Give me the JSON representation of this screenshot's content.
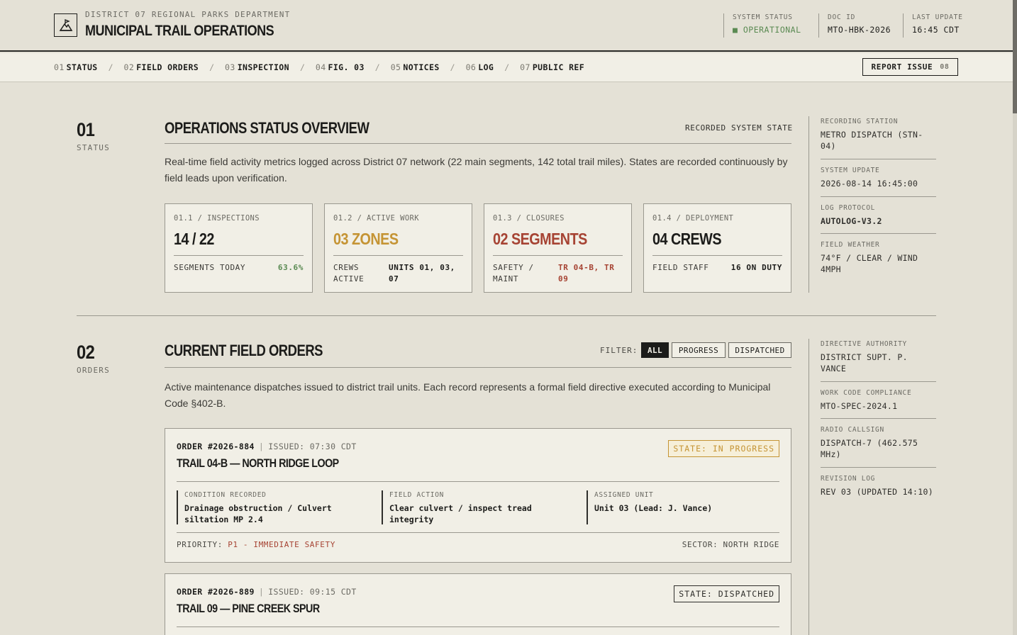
{
  "header": {
    "department": "DISTRICT 07 REGIONAL PARKS DEPARTMENT",
    "title": "MUNICIPAL TRAIL OPERATIONS",
    "system_status_label": "SYSTEM STATUS",
    "system_status_value": "OPERATIONAL",
    "doc_id_label": "DOC ID",
    "doc_id_value": "MTO-HBK-2026",
    "last_update_label": "LAST UPDATE",
    "last_update_value": "16:45 CDT"
  },
  "nav": {
    "items": [
      {
        "num": "01",
        "label": "STATUS"
      },
      {
        "num": "02",
        "label": "FIELD ORDERS"
      },
      {
        "num": "03",
        "label": "INSPECTION"
      },
      {
        "num": "04",
        "label": "FIG. 03"
      },
      {
        "num": "05",
        "label": "NOTICES"
      },
      {
        "num": "06",
        "label": "LOG"
      },
      {
        "num": "07",
        "label": "PUBLIC REF"
      }
    ],
    "separator": "/",
    "report_label": "REPORT ISSUE",
    "report_count": "08"
  },
  "section1": {
    "num": "01",
    "tag": "STATUS",
    "title": "OPERATIONS STATUS OVERVIEW",
    "right_label": "RECORDED SYSTEM STATE",
    "description": "Real-time field activity metrics logged across District 07 network (22 main segments, 142 total trail miles). States are recorded continuously by field leads upon verification.",
    "cards": [
      {
        "label": "01.1 / INSPECTIONS",
        "value": "14 / 22",
        "foot_left": "SEGMENTS TODAY",
        "foot_right": "63.6%"
      },
      {
        "label": "01.2 / ACTIVE WORK",
        "value": "03 ZONES",
        "foot_left": "CREWS\nACTIVE",
        "foot_right": "UNITS 01, 03,\n07"
      },
      {
        "label": "01.3 / CLOSURES",
        "value": "02 SEGMENTS",
        "foot_left": "SAFETY /\nMAINT",
        "foot_right": "TR 04-B, TR\n09"
      },
      {
        "label": "01.4 / DEPLOYMENT",
        "value": "04 CREWS",
        "foot_left": "FIELD STAFF",
        "foot_right": "16 ON DUTY"
      }
    ],
    "side": [
      {
        "label": "RECORDING STATION",
        "value": "METRO DISPATCH (STN-04)"
      },
      {
        "label": "SYSTEM UPDATE",
        "value": "2026-08-14 16:45:00"
      },
      {
        "label": "LOG PROTOCOL",
        "value": "AUTOLOG-V3.2"
      },
      {
        "label": "FIELD WEATHER",
        "value": "74°F / CLEAR / WIND 4MPH"
      }
    ]
  },
  "section2": {
    "num": "02",
    "tag": "ORDERS",
    "title": "CURRENT FIELD ORDERS",
    "filter_label": "FILTER:",
    "filters": [
      "ALL",
      "PROGRESS",
      "DISPATCHED"
    ],
    "description": "Active maintenance dispatches issued to district trail units. Each record represents a formal field directive executed according to Municipal Code §402-B.",
    "orders": [
      {
        "id": "ORDER #2026-884",
        "issued": "ISSUED: 07:30 CDT",
        "name": "TRAIL 04-B — NORTH RIDGE LOOP",
        "state": "STATE: IN PROGRESS",
        "condition_label": "CONDITION RECORDED",
        "condition_value": "Drainage obstruction / Culvert siltation MP 2.4",
        "action_label": "FIELD ACTION",
        "action_value": "Clear culvert / inspect tread integrity",
        "unit_label": "ASSIGNED UNIT",
        "unit_value": "Unit 03 (Lead: J. Vance)",
        "priority_label": "PRIORITY:",
        "priority_value": "P1 - IMMEDIATE SAFETY",
        "sector": "SECTOR: NORTH RIDGE"
      },
      {
        "id": "ORDER #2026-889",
        "issued": "ISSUED: 09:15 CDT",
        "name": "TRAIL 09 — PINE CREEK SPUR",
        "state": "STATE: DISPATCHED"
      }
    ],
    "side": [
      {
        "label": "DIRECTIVE AUTHORITY",
        "value": "DISTRICT SUPT. P. VANCE"
      },
      {
        "label": "WORK CODE COMPLIANCE",
        "value": "MTO-SPEC-2024.1"
      },
      {
        "label": "RADIO CALLSIGN",
        "value": "DISPATCH-7 (462.575 MHz)"
      },
      {
        "label": "REVISION LOG",
        "value": "REV 03 (UPDATED 14:10)"
      }
    ]
  },
  "colors": {
    "background": "#e4e1d6",
    "panel": "#f1efe6",
    "ink": "#1c1c1a",
    "gold": "#c59434",
    "red": "#a64333",
    "green": "#5a8a52"
  }
}
